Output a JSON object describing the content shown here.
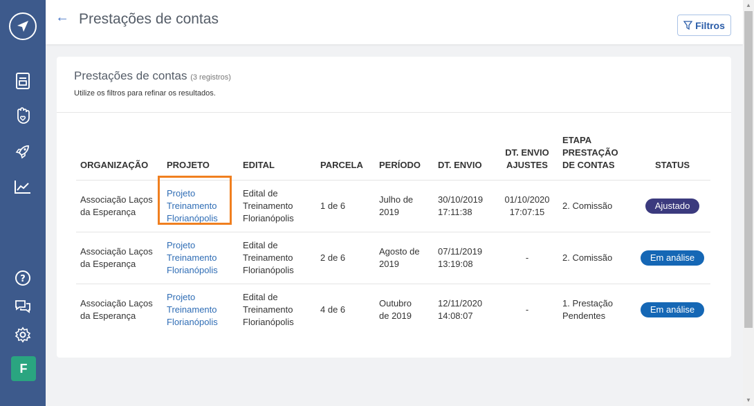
{
  "header": {
    "title": "Prestações de contas",
    "filter_label": "Filtros"
  },
  "sidebar": {
    "icons": [
      "logo-compass-icon",
      "document-icon",
      "hand-heart-icon",
      "rocket-icon",
      "chart-icon",
      "help-icon",
      "chat-icon",
      "settings-icon"
    ],
    "avatar_letter": "F"
  },
  "card": {
    "title": "Prestações de contas",
    "count": "(3 registros)",
    "subtitle": "Utilize os filtros para refinar os resultados."
  },
  "table": {
    "headers": {
      "organizacao": "ORGANIZAÇÃO",
      "projeto": "PROJETO",
      "edital": "EDITAL",
      "parcela": "PARCELA",
      "periodo": "PERÍODO",
      "dt_envio": "DT. ENVIO",
      "dt_envio_ajustes_1": "DT. ENVIO",
      "dt_envio_ajustes_2": "AJUSTES",
      "etapa_1": "ETAPA",
      "etapa_2": "PRESTAÇÃO",
      "etapa_3": "DE CONTAS",
      "status": "STATUS"
    },
    "rows": [
      {
        "org_1": "Associação Laços",
        "org_2": "da Esperança",
        "proj_1": "Projeto",
        "proj_2": "Treinamento",
        "proj_3": "Florianópolis",
        "edital_1": "Edital de",
        "edital_2": "Treinamento",
        "edital_3": "Florianópolis",
        "parcela": "1 de 6",
        "periodo_1": "Julho de",
        "periodo_2": "2019",
        "envio_1": "30/10/2019",
        "envio_2": "17:11:38",
        "ajustes_1": "01/10/2020",
        "ajustes_2": "17:07:15",
        "etapa_1": "2. Comissão",
        "etapa_2": "",
        "status": "Ajustado",
        "status_color": "#3b3a7e"
      },
      {
        "org_1": "Associação Laços",
        "org_2": "da Esperança",
        "proj_1": "Projeto",
        "proj_2": "Treinamento",
        "proj_3": "Florianópolis",
        "edital_1": "Edital de",
        "edital_2": "Treinamento",
        "edital_3": "Florianópolis",
        "parcela": "2 de 6",
        "periodo_1": "Agosto de",
        "periodo_2": "2019",
        "envio_1": "07/11/2019",
        "envio_2": "13:19:08",
        "ajustes_1": "-",
        "ajustes_2": "",
        "etapa_1": "2. Comissão",
        "etapa_2": "",
        "status": "Em análise",
        "status_color": "#1567b5"
      },
      {
        "org_1": "Associação Laços",
        "org_2": "da Esperança",
        "proj_1": "Projeto",
        "proj_2": "Treinamento",
        "proj_3": "Florianópolis",
        "edital_1": "Edital de",
        "edital_2": "Treinamento",
        "edital_3": "Florianópolis",
        "parcela": "4 de 6",
        "periodo_1": "Outubro",
        "periodo_2": "de 2019",
        "envio_1": "12/11/2020",
        "envio_2": "14:08:07",
        "ajustes_1": "-",
        "ajustes_2": "",
        "etapa_1": "1. Prestação",
        "etapa_2": "Pendentes",
        "status": "Em análise",
        "status_color": "#1567b5"
      }
    ]
  },
  "colors": {
    "sidebar": "#3d5a8c",
    "link": "#2f6db5",
    "highlight": "#f07f1f",
    "avatar": "#2aa580"
  }
}
